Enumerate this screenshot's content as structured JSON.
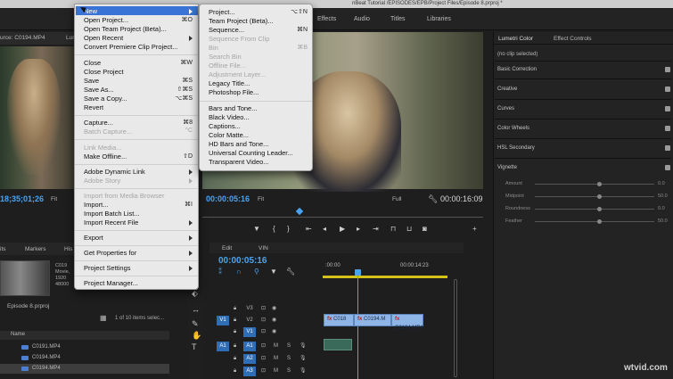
{
  "titlebar": {
    "text": "nBeat Tutorial /EPISODES/EPB/Project Files/Episode 8.prproj *"
  },
  "workspaces": [
    "Effects",
    "Audio",
    "Titles",
    "Libraries"
  ],
  "source": {
    "tab": "urce: C0194.MP4",
    "tab2": "Lum",
    "timecode": "18;35;01;26",
    "fit": "Fit"
  },
  "program": {
    "timecode": "00:00:05:16",
    "fit": "Fit",
    "quality": "Full",
    "duration": "00:00:16:09"
  },
  "project": {
    "tabs": [
      "its",
      "Markers",
      "His"
    ],
    "meta": [
      "C019",
      "Movie,",
      "1920",
      "48000"
    ],
    "name": "Episode 8.prproj",
    "count": "1 of 10 items selec...",
    "column": "Name",
    "items": [
      "C0191.MP4",
      "C0194.MP4",
      "C0194.MP4"
    ]
  },
  "timeline": {
    "tabs": [
      "Edit",
      "VIN"
    ],
    "timecode": "00:00:05:16",
    "ruler": [
      ":00:00",
      "00:00:14:23"
    ],
    "tracks": [
      {
        "src": "",
        "label": "V3",
        "on": false
      },
      {
        "src": "V1",
        "label": "V2",
        "on": false
      },
      {
        "src": "",
        "label": "V1",
        "on": true
      },
      {
        "src": "A1",
        "label": "A1",
        "on": true
      },
      {
        "src": "",
        "label": "A2",
        "on": true
      },
      {
        "src": "",
        "label": "A3",
        "on": true
      }
    ],
    "clips": [
      "C018",
      "C0194.M",
      "C0194.MP4"
    ]
  },
  "lumetri": {
    "tabs": [
      "Lumetri Color",
      "Effect Controls"
    ],
    "noclip": "(no clip selected)",
    "sections": [
      "Basic Correction",
      "Creative",
      "Curves",
      "Color Wheels",
      "HSL Secondary",
      "Vignette"
    ],
    "vignette": [
      {
        "label": "Amount",
        "value": "0.0"
      },
      {
        "label": "Midpoint",
        "value": "50.0"
      },
      {
        "label": "Roundness",
        "value": "0.0"
      },
      {
        "label": "Feather",
        "value": "50.0"
      }
    ]
  },
  "file_menu": {
    "items": [
      {
        "label": "New",
        "sc": "",
        "arrow": true,
        "dis": false
      },
      {
        "label": "Open Project...",
        "sc": "⌘O",
        "arrow": false,
        "dis": false
      },
      {
        "label": "Open Team Project (Beta)...",
        "sc": "",
        "arrow": false,
        "dis": false
      },
      {
        "label": "Open Recent",
        "sc": "",
        "arrow": true,
        "dis": false
      },
      {
        "label": "Convert Premiere Clip Project...",
        "sc": "",
        "arrow": false,
        "dis": false
      },
      {
        "label": "Close",
        "sc": "⌘W",
        "arrow": false,
        "dis": false
      },
      {
        "label": "Close Project",
        "sc": "",
        "arrow": false,
        "dis": false
      },
      {
        "label": "Save",
        "sc": "⌘S",
        "arrow": false,
        "dis": false
      },
      {
        "label": "Save As...",
        "sc": "⇧⌘S",
        "arrow": false,
        "dis": false
      },
      {
        "label": "Save a Copy...",
        "sc": "⌥⌘S",
        "arrow": false,
        "dis": false
      },
      {
        "label": "Revert",
        "sc": "",
        "arrow": false,
        "dis": false
      },
      {
        "label": "Capture...",
        "sc": "⌘8",
        "arrow": false,
        "dis": false
      },
      {
        "label": "Batch Capture...",
        "sc": "^C",
        "arrow": false,
        "dis": true
      },
      {
        "label": "Link Media...",
        "sc": "",
        "arrow": false,
        "dis": true
      },
      {
        "label": "Make Offline...",
        "sc": "⇧D",
        "arrow": false,
        "dis": false
      },
      {
        "label": "Adobe Dynamic Link",
        "sc": "",
        "arrow": true,
        "dis": false
      },
      {
        "label": "Adobe Story",
        "sc": "",
        "arrow": true,
        "dis": true
      },
      {
        "label": "Import from Media Browser",
        "sc": "",
        "arrow": false,
        "dis": true
      },
      {
        "label": "Import...",
        "sc": "⌘I",
        "arrow": false,
        "dis": false
      },
      {
        "label": "Import Batch List...",
        "sc": "",
        "arrow": false,
        "dis": false
      },
      {
        "label": "Import Recent File",
        "sc": "",
        "arrow": true,
        "dis": false
      },
      {
        "label": "Export",
        "sc": "",
        "arrow": true,
        "dis": false
      },
      {
        "label": "Get Properties for",
        "sc": "",
        "arrow": true,
        "dis": false
      },
      {
        "label": "Project Settings",
        "sc": "",
        "arrow": true,
        "dis": false
      },
      {
        "label": "Project Manager...",
        "sc": "",
        "arrow": false,
        "dis": false
      }
    ]
  },
  "new_menu": {
    "items": [
      {
        "label": "Project...",
        "sc": "⌥⇧N",
        "dis": false
      },
      {
        "label": "Team Project (Beta)...",
        "sc": "",
        "dis": false
      },
      {
        "label": "Sequence...",
        "sc": "⌘N",
        "dis": false
      },
      {
        "label": "Sequence From Clip",
        "sc": "",
        "dis": true
      },
      {
        "label": "Bin",
        "sc": "⌘B",
        "dis": true
      },
      {
        "label": "Search Bin",
        "sc": "",
        "dis": true
      },
      {
        "label": "Offline File...",
        "sc": "",
        "dis": true
      },
      {
        "label": "Adjustment Layer...",
        "sc": "",
        "dis": true
      },
      {
        "label": "Legacy Title...",
        "sc": "",
        "dis": false
      },
      {
        "label": "Photoshop File...",
        "sc": "",
        "dis": false
      },
      {
        "label": "Bars and Tone...",
        "sc": "",
        "dis": false
      },
      {
        "label": "Black Video...",
        "sc": "",
        "dis": false
      },
      {
        "label": "Captions...",
        "sc": "",
        "dis": false
      },
      {
        "label": "Color Matte...",
        "sc": "",
        "dis": false
      },
      {
        "label": "HD Bars and Tone...",
        "sc": "",
        "dis": false
      },
      {
        "label": "Universal Counting Leader...",
        "sc": "",
        "dis": false
      },
      {
        "label": "Transparent Video...",
        "sc": "",
        "dis": false
      }
    ]
  },
  "watermark": "wtvid.com"
}
